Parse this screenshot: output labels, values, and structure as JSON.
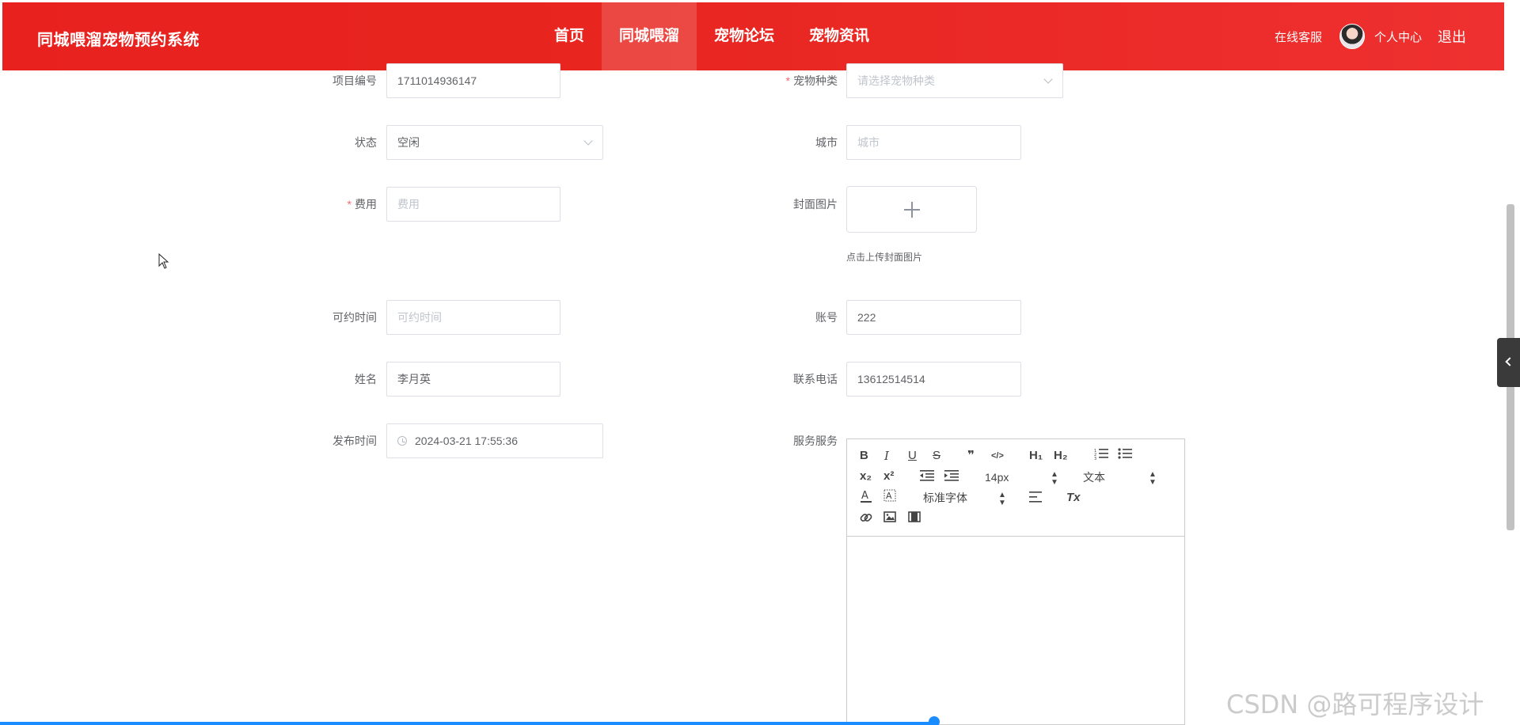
{
  "header": {
    "brand": "同城喂溜宠物预约系统",
    "nav": [
      "首页",
      "同城喂溜",
      "宠物论坛",
      "宠物资讯"
    ],
    "active_nav": "同城喂溜",
    "service_label": "在线客服",
    "personal_label": "个人中心",
    "logout_label": "退出",
    "colors": {
      "bar": "#e8211f"
    }
  },
  "form": {
    "item_no": {
      "label": "项目编号",
      "value": "1711014936147"
    },
    "pet_type": {
      "label": "宠物种类",
      "placeholder": "请选择宠物种类",
      "required": true
    },
    "status": {
      "label": "状态",
      "value": "空闲"
    },
    "city": {
      "label": "城市",
      "placeholder": "城市"
    },
    "fee": {
      "label": "费用",
      "placeholder": "费用",
      "required": true
    },
    "cover": {
      "label": "封面图片",
      "tip": "点击上传封面图片"
    },
    "available_time": {
      "label": "可约时间",
      "placeholder": "可约时间"
    },
    "account": {
      "label": "账号",
      "value": "222"
    },
    "name": {
      "label": "姓名",
      "value": "李月英"
    },
    "phone": {
      "label": "联系电话",
      "value": "13612514514"
    },
    "publish_time": {
      "label": "发布时间",
      "value": "2024-03-21 17:55:36"
    },
    "service": {
      "label": "服务服务"
    }
  },
  "editor": {
    "bold": "B",
    "italic": "I",
    "underline": "U",
    "strike": "S",
    "quote": "❞",
    "code": "</>",
    "h1": "H₁",
    "h2": "H₂",
    "sub": "x₂",
    "sup": "x²",
    "size_value": "14px",
    "header_value": "文本",
    "font_value": "标准字体",
    "clean": "Tx"
  },
  "watermark": "CSDN @路可程序设计"
}
